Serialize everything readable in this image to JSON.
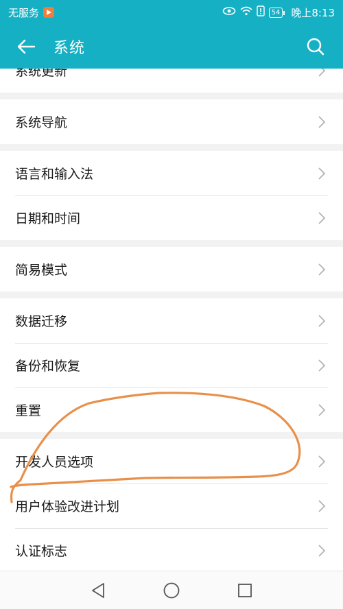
{
  "status_bar": {
    "carrier": "无服务",
    "battery": "54",
    "time": "晚上8:13"
  },
  "app_bar": {
    "title": "系统"
  },
  "groups": [
    {
      "items": [
        {
          "label": "系统更新"
        }
      ]
    },
    {
      "items": [
        {
          "label": "系统导航"
        }
      ]
    },
    {
      "items": [
        {
          "label": "语言和输入法"
        },
        {
          "label": "日期和时间"
        }
      ]
    },
    {
      "items": [
        {
          "label": "简易模式"
        }
      ]
    },
    {
      "items": [
        {
          "label": "数据迁移"
        },
        {
          "label": "备份和恢复"
        },
        {
          "label": "重置"
        }
      ]
    },
    {
      "items": [
        {
          "label": "开发人员选项"
        },
        {
          "label": "用户体验改进计划"
        },
        {
          "label": "认证标志"
        }
      ]
    }
  ],
  "colors": {
    "accent": "#16b0c4",
    "annotation": "#e8904a"
  }
}
